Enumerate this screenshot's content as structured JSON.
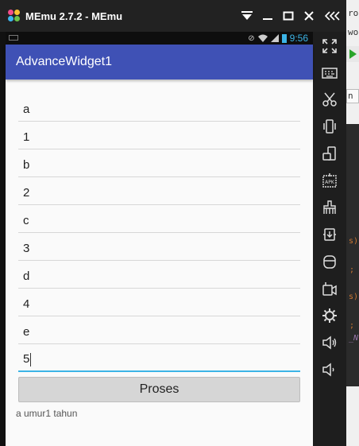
{
  "window": {
    "title": "MEmu 2.7.2 - MEmu",
    "controls": [
      "filter-icon",
      "minimize-icon",
      "maximize-icon",
      "close-icon",
      "collapse-icon"
    ]
  },
  "status_bar": {
    "time": "9:56"
  },
  "app": {
    "title": "AdvanceWidget1",
    "fields": [
      {
        "value": "a"
      },
      {
        "value": "1"
      },
      {
        "value": "b"
      },
      {
        "value": "2"
      },
      {
        "value": "c"
      },
      {
        "value": "3"
      },
      {
        "value": "d"
      },
      {
        "value": "4"
      },
      {
        "value": "e"
      },
      {
        "value": "5"
      }
    ],
    "button_label": "Proses",
    "result_text": "a umur1 tahun"
  },
  "toolbar": {
    "icons": [
      "fullscreen-icon",
      "keyboard-icon",
      "scissors-icon",
      "shake-icon",
      "rotate-icon",
      "apk-icon",
      "sweep-icon",
      "transfer-icon",
      "storage-icon",
      "screen-record-icon",
      "settings-icon",
      "volume-up-icon",
      "volume-down-icon"
    ]
  },
  "background_ide": {
    "lines": [
      "ro",
      "wo",
      "n"
    ],
    "accent_color": "#cc7832"
  },
  "colors": {
    "actionbar": "#3f51b5",
    "focus_underline": "#3cb4e6",
    "titlebar": "#222222",
    "toolbar": "#1e1e1e"
  }
}
